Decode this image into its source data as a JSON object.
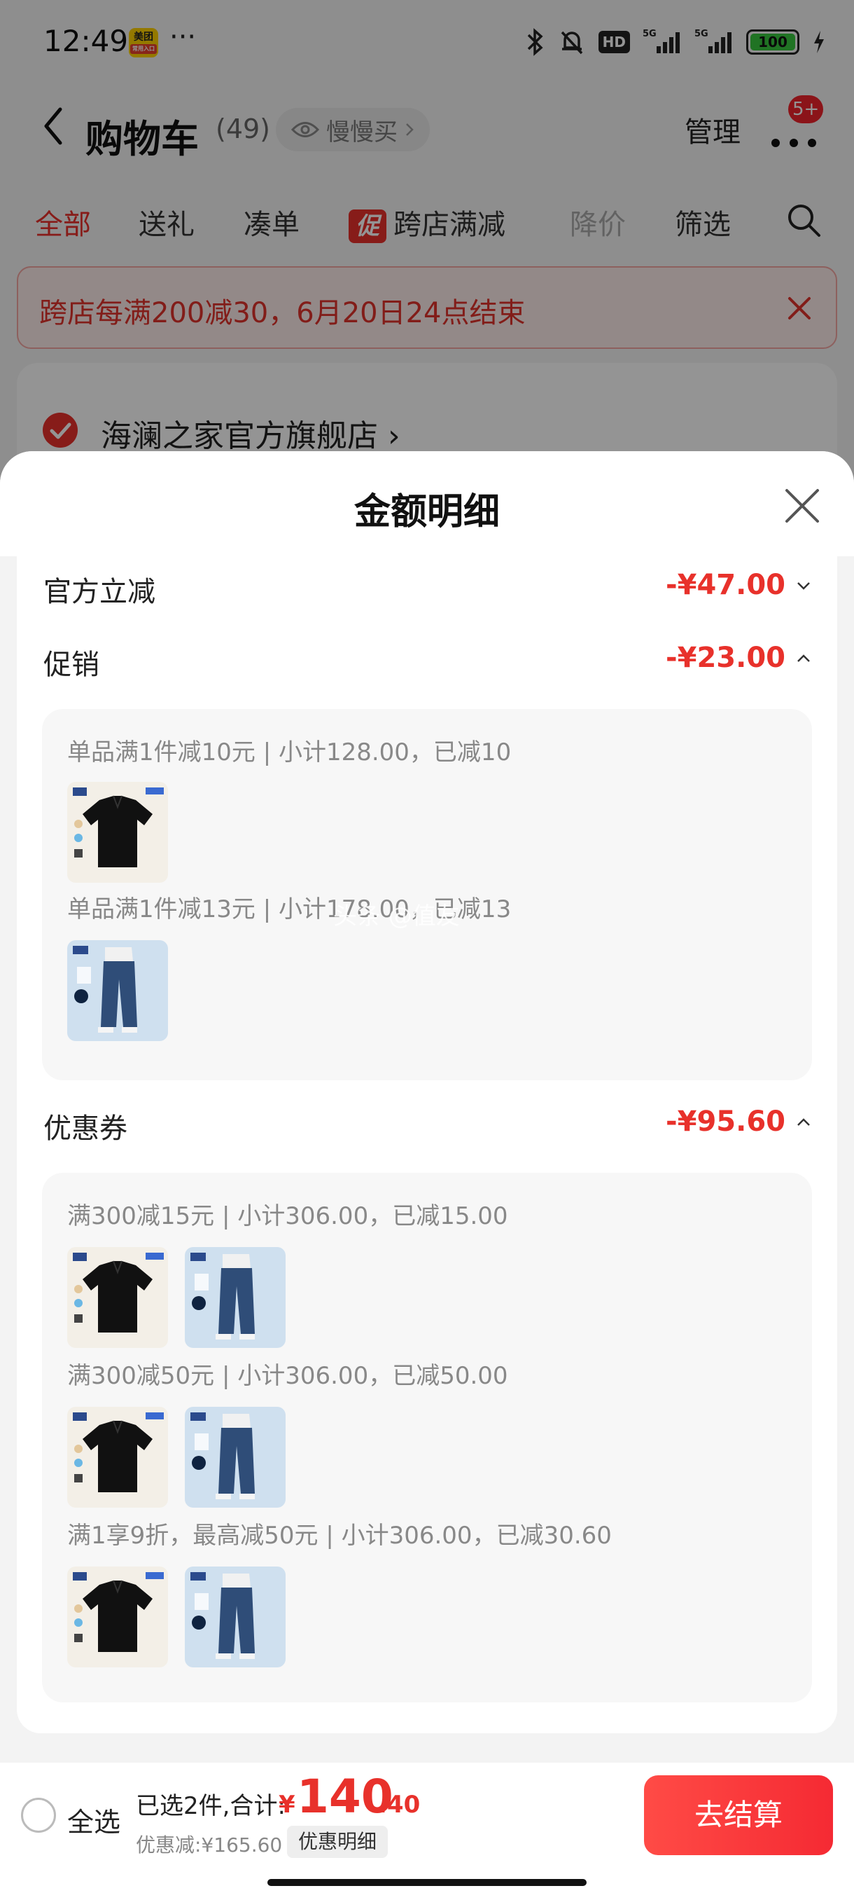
{
  "status_bar": {
    "time": "12:49",
    "app_badge": "美团",
    "app_badge_sub": "常用入口",
    "dots": "···",
    "hd": "HD",
    "network": "5G",
    "battery": "100"
  },
  "nav": {
    "title": "购物车",
    "count": "(49)",
    "slow_buy": "慢慢买",
    "manage": "管理",
    "more_badge": "5+"
  },
  "tabs": [
    {
      "label": "全部"
    },
    {
      "label": "送礼"
    },
    {
      "label": "凑单"
    },
    {
      "label": "跨店满减",
      "tag": "促"
    },
    {
      "label": "降价"
    },
    {
      "label": "筛选"
    }
  ],
  "promo_banner": {
    "text": "跨店每满200减30，6月20日24点结束"
  },
  "store": {
    "name": "海澜之家官方旗舰店 ›"
  },
  "sheet": {
    "title": "金额明细",
    "lines": [
      {
        "label": "官方立减",
        "amount": "-¥47.00",
        "expanded": false
      },
      {
        "label": "促销",
        "amount": "-¥23.00",
        "expanded": true
      },
      {
        "label": "优惠券",
        "amount": "-¥95.60",
        "expanded": true
      }
    ],
    "promo_rules": [
      {
        "text": "单品满1件减10元 | 小计128.00，已减10",
        "items": [
          "polo"
        ]
      },
      {
        "text": "单品满1件减13元 | 小计178.00，已减13",
        "items": [
          "jeans"
        ]
      }
    ],
    "coupon_rules": [
      {
        "text": "满300减15元 | 小计306.00，已减15.00",
        "items": [
          "polo",
          "jeans"
        ]
      },
      {
        "text": "满300减50元 | 小计306.00，已减50.00",
        "items": [
          "polo",
          "jeans"
        ]
      },
      {
        "text": "满1享9折，最高减50元 | 小计306.00，已减30.60",
        "items": [
          "polo",
          "jeans"
        ]
      }
    ],
    "watermark": "头条 @值友"
  },
  "bottom_bar": {
    "select_all": "全选",
    "summary": "已选2件,合计:",
    "currency": "¥",
    "price_int": "140",
    "price_dec": ".40",
    "discount": "优惠减:¥165.60",
    "detail_button": "优惠明细",
    "checkout": "去结算"
  },
  "colors": {
    "accent": "#e8312b",
    "checkout": "#f52a33"
  }
}
